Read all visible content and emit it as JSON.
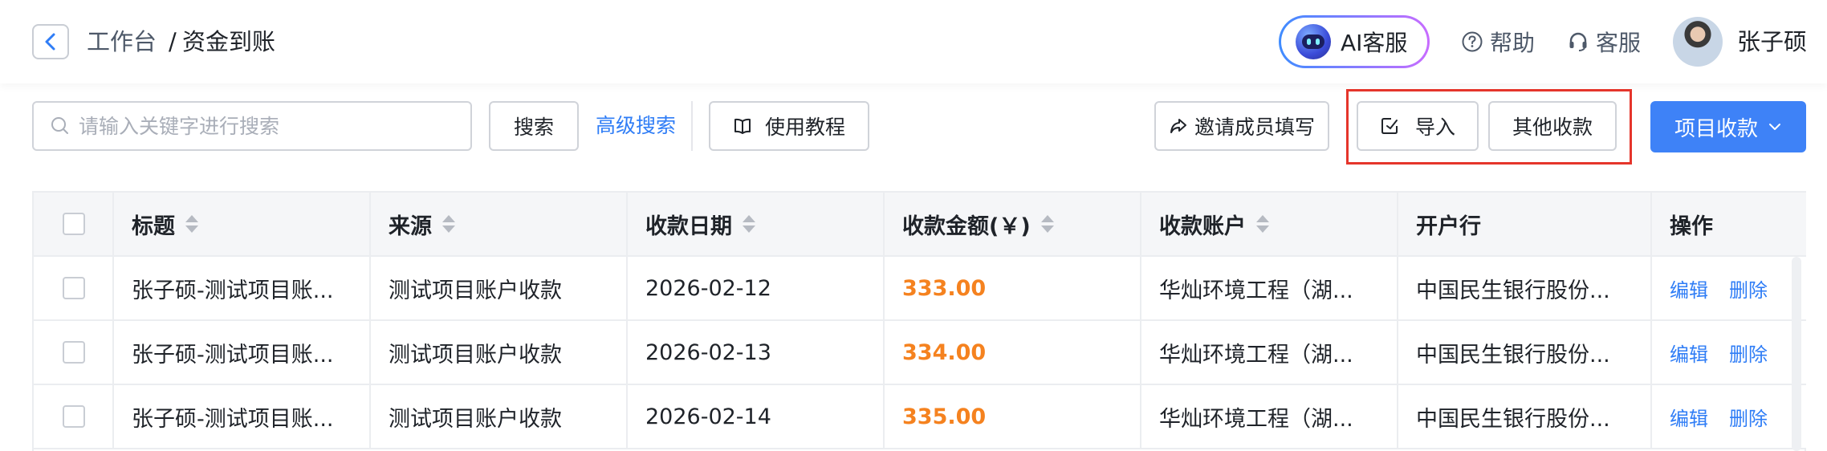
{
  "header": {
    "breadcrumb_root": "工作台",
    "breadcrumb_separator": "/",
    "breadcrumb_current": "资金到账",
    "ai_service_label": "AI客服",
    "help_label": "帮助",
    "service_label": "客服",
    "user_name": "张子硕"
  },
  "toolbar": {
    "search_placeholder": "请输入关键字进行搜索",
    "search_value": "",
    "search_button": "搜索",
    "advanced_search": "高级搜索",
    "tutorial_button": "使用教程",
    "invite_button": "邀请成员填写",
    "import_button": "导入",
    "other_payment_button": "其他收款",
    "project_payment_button": "项目收款"
  },
  "table": {
    "headers": {
      "title": "标题",
      "source": "来源",
      "date": "收款日期",
      "amount": "收款金额(￥)",
      "account": "收款账户",
      "bank": "开户行",
      "actions": "操作"
    },
    "rows": [
      {
        "title": "张子硕-测试项目账...",
        "source": "测试项目账户收款",
        "date": "2026-02-12",
        "amount": "333.00",
        "account": "华灿环境工程（湖...",
        "bank": "中国民生银行股份...",
        "edit": "编辑",
        "delete": "删除"
      },
      {
        "title": "张子硕-测试项目账...",
        "source": "测试项目账户收款",
        "date": "2026-02-13",
        "amount": "334.00",
        "account": "华灿环境工程（湖...",
        "bank": "中国民生银行股份...",
        "edit": "编辑",
        "delete": "删除"
      },
      {
        "title": "张子硕-测试项目账...",
        "source": "测试项目账户收款",
        "date": "2026-02-14",
        "amount": "335.00",
        "account": "华灿环境工程（湖...",
        "bank": "中国民生银行股份...",
        "edit": "编辑",
        "delete": "删除"
      }
    ]
  },
  "colors": {
    "primary": "#3e82f7",
    "link": "#2f7df6",
    "amount": "#f5821f",
    "highlight_frame": "#e5352b"
  },
  "icons": [
    "chevron-left-icon",
    "robot-icon",
    "question-circle-icon",
    "headset-icon",
    "search-icon",
    "book-icon",
    "share-icon",
    "import-icon",
    "chevron-down-icon",
    "sort-icon"
  ]
}
